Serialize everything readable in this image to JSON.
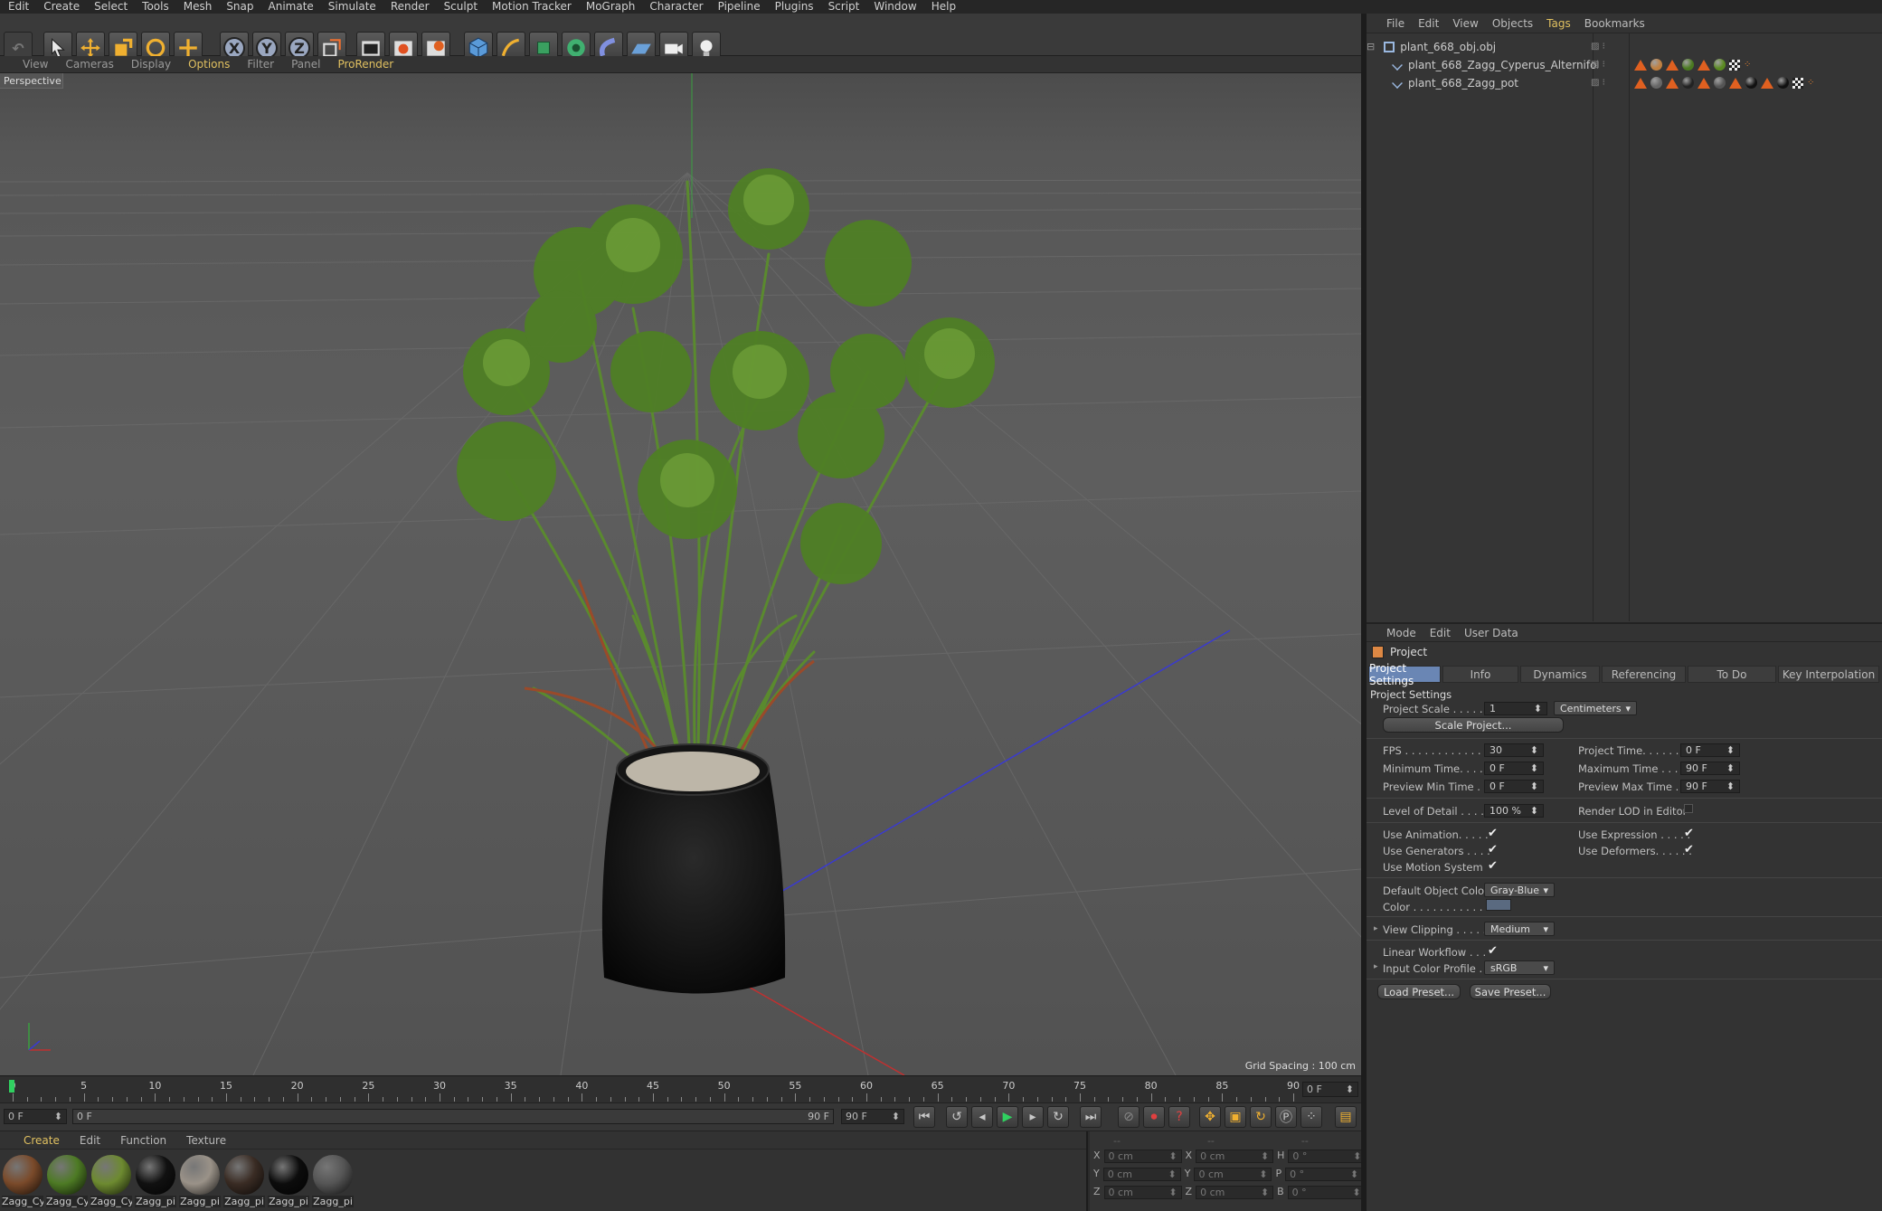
{
  "menubar": [
    "Edit",
    "Create",
    "Select",
    "Tools",
    "Mesh",
    "Snap",
    "Animate",
    "Simulate",
    "Render",
    "Sculpt",
    "Motion Tracker",
    "MoGraph",
    "Character",
    "Pipeline",
    "Plugins",
    "Script",
    "Window",
    "Help"
  ],
  "toolbar": {
    "axis_x": "X",
    "axis_y": "Y",
    "axis_z": "Z"
  },
  "viewport_menu": [
    {
      "label": "View",
      "active": false
    },
    {
      "label": "Cameras",
      "active": false
    },
    {
      "label": "Display",
      "active": false
    },
    {
      "label": "Options",
      "active": true
    },
    {
      "label": "Filter",
      "active": false
    },
    {
      "label": "Panel",
      "active": false
    },
    {
      "label": "ProRender",
      "active": true
    }
  ],
  "viewport": {
    "label": "Perspective",
    "grid_spacing": "Grid Spacing : 100 cm"
  },
  "timeline": {
    "ticks": [
      "0",
      "5",
      "10",
      "15",
      "20",
      "25",
      "30",
      "35",
      "40",
      "45",
      "50",
      "55",
      "60",
      "65",
      "70",
      "75",
      "80",
      "85",
      "90"
    ],
    "current_frame": "0 F"
  },
  "playbar": {
    "start_frame": "0 F",
    "slider_start": "0 F",
    "slider_end": "90 F",
    "end_frame": "90 F"
  },
  "material_manager": {
    "menu": [
      {
        "label": "Create",
        "active": true
      },
      {
        "label": "Edit",
        "active": false
      },
      {
        "label": "Function",
        "active": false
      },
      {
        "label": "Texture",
        "active": false
      }
    ],
    "materials": [
      {
        "label": "Zagg_Cy",
        "color": "#7a4a2a"
      },
      {
        "label": "Zagg_Cy",
        "color": "#4d7a24"
      },
      {
        "label": "Zagg_Cy",
        "color": "#6d8a30"
      },
      {
        "label": "Zagg_pi",
        "color": "#111111"
      },
      {
        "label": "Zagg_pi",
        "color": "#9a9288"
      },
      {
        "label": "Zagg_pi",
        "color": "#3a2c24"
      },
      {
        "label": "Zagg_pi",
        "color": "#0c0c0c"
      },
      {
        "label": "Zagg_pi",
        "color": "#555555"
      }
    ]
  },
  "coordinates": {
    "header": [
      "--",
      "--",
      "--"
    ],
    "rows": [
      {
        "a": "X",
        "av": "0 cm",
        "b": "X",
        "bv": "0 cm",
        "c": "H",
        "cv": "0 °"
      },
      {
        "a": "Y",
        "av": "0 cm",
        "b": "Y",
        "bv": "0 cm",
        "c": "P",
        "cv": "0 °"
      },
      {
        "a": "Z",
        "av": "0 cm",
        "b": "Z",
        "bv": "0 cm",
        "c": "B",
        "cv": "0 °"
      }
    ]
  },
  "object_manager": {
    "menu": [
      {
        "label": "File",
        "active": false
      },
      {
        "label": "Edit",
        "active": false
      },
      {
        "label": "View",
        "active": false
      },
      {
        "label": "Objects",
        "active": false
      },
      {
        "label": "Tags",
        "active": true
      },
      {
        "label": "Bookmarks",
        "active": false
      }
    ],
    "objects": [
      {
        "name": "plant_668_obj.obj",
        "level": 0
      },
      {
        "name": "plant_668_Zagg_Cyperus_Alternifolius",
        "level": 1
      },
      {
        "name": "plant_668_Zagg_pot",
        "level": 1
      }
    ]
  },
  "attribute_manager": {
    "menu": [
      "Mode",
      "Edit",
      "User Data"
    ],
    "title": "Project",
    "tabs": [
      {
        "label": "Project Settings",
        "active": true
      },
      {
        "label": "Info",
        "active": false
      },
      {
        "label": "Dynamics",
        "active": false
      },
      {
        "label": "Referencing",
        "active": false
      },
      {
        "label": "To Do",
        "active": false
      },
      {
        "label": "Key Interpolation",
        "active": false
      }
    ],
    "section": "Project Settings",
    "project_scale_label": "Project Scale . . . . . .",
    "project_scale_value": "1",
    "project_scale_unit": "Centimeters",
    "scale_project_button": "Scale Project...",
    "fps_label": "FPS . . . . . . . . . . . . . .",
    "fps_value": "30",
    "project_time_label": "Project Time. . . . . . . .",
    "project_time_value": "0 F",
    "min_time_label": "Minimum Time. . . . . .",
    "min_time_value": "0 F",
    "max_time_label": "Maximum Time . . . . .",
    "max_time_value": "90 F",
    "preview_min_label": "Preview Min Time . . .",
    "preview_min_value": "0 F",
    "preview_max_label": "Preview Max Time . . .",
    "preview_max_value": "90 F",
    "lod_label": "Level of Detail . . . . .",
    "lod_value": "100 %",
    "render_lod_label": "Render LOD in Editor",
    "use_animation_label": "Use Animation. . . . .",
    "use_expression_label": "Use Expression . . . . .",
    "use_generators_label": "Use Generators . . . .",
    "use_deformers_label": "Use Deformers. . . . . .",
    "use_motion_label": "Use Motion System",
    "default_color_label": "Default Object Color",
    "default_color_value": "Gray-Blue",
    "color_label": "Color . . . . . . . . . . .",
    "view_clipping_label": "View Clipping . . . . .",
    "view_clipping_value": "Medium",
    "linear_workflow_label": "Linear Workflow . . .",
    "input_profile_label": "Input Color Profile . .",
    "input_profile_value": "sRGB",
    "load_preset": "Load Preset...",
    "save_preset": "Save Preset..."
  },
  "colors": {
    "accent": "#e0c060",
    "tab_active": "#6a86b4",
    "object_color": "#5a6a80"
  }
}
